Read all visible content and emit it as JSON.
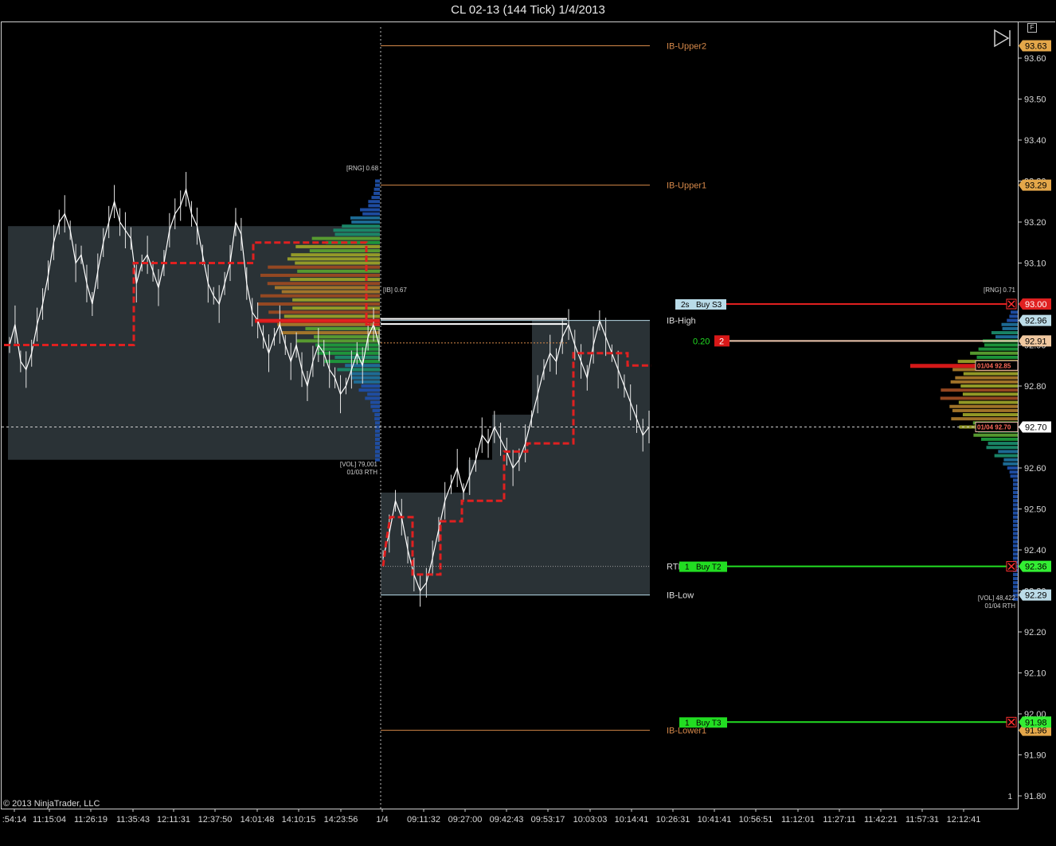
{
  "title": "CL 02-13 (144 Tick)  1/4/2013",
  "copyright": "© 2013 NinjaTrader, LLC",
  "panel_button": "F",
  "colors": {
    "orange": "#d6894a",
    "red": "#e02020",
    "green": "#22dd22",
    "lightblue": "#b9dbe8",
    "box": "#2a3236",
    "grid_text": "#d8d8d8"
  },
  "chart_data": {
    "type": "line",
    "y_axis": {
      "range": [
        91.76,
        93.67
      ],
      "ticks": [
        "93.60",
        "93.50",
        "93.40",
        "93.30",
        "93.20",
        "93.10",
        "93.00",
        "92.90",
        "92.80",
        "92.70",
        "92.60",
        "92.50",
        "92.40",
        "92.30",
        "92.20",
        "92.10",
        "92.00",
        "91.90",
        "91.80"
      ],
      "bottom_marker": "1"
    },
    "x_axis": {
      "ticks": [
        ":54:14",
        "11:15:04",
        "11:26:19",
        "11:35:43",
        "12:11:31",
        "12:37:50",
        "14:01:48",
        "14:10:15",
        "14:23:56",
        "1/4",
        "09:11:32",
        "09:27:00",
        "09:42:43",
        "09:53:17",
        "10:03:03",
        "10:14:41",
        "10:26:31",
        "10:41:41",
        "10:56:51",
        "11:12:01",
        "11:27:11",
        "11:42:21",
        "11:57:31",
        "12:12:41"
      ]
    },
    "levels": [
      {
        "name": "IB-Upper2",
        "price": 93.63,
        "tag": "93.63",
        "color": "orange"
      },
      {
        "name": "IB-Upper1",
        "price": 93.29,
        "tag": "93.29",
        "color": "orange"
      },
      {
        "name": "IB-High",
        "price": 92.96,
        "tag": "92.96",
        "color": "lightblue"
      },
      {
        "name": "RTH Open",
        "price": 92.36,
        "tag": "",
        "color": "gray"
      },
      {
        "name": "IB-Low",
        "price": 92.29,
        "tag": "92.29",
        "color": "lightblue"
      },
      {
        "name": "IB-Lower1",
        "price": 91.96,
        "tag": "91.96",
        "color": "orange"
      }
    ],
    "orders": [
      {
        "label": "Buy S3",
        "qty": "2s",
        "price": 93.0,
        "tag": "93.00",
        "kind": "stop"
      },
      {
        "label": "Buy T2",
        "qty": "1",
        "price": 92.36,
        "tag": "92.36",
        "kind": "target"
      },
      {
        "label": "Buy T3",
        "qty": "1",
        "price": 91.98,
        "tag": "91.98",
        "kind": "target"
      }
    ],
    "position": {
      "pnl": "0.20",
      "qty": "2",
      "price": 92.91,
      "tag": "92.91"
    },
    "current_price": {
      "price": 92.7,
      "tag": "92.70",
      "label": "01/04 92.70"
    },
    "poc_label": {
      "price": 92.85,
      "label": "01/04 92.85"
    },
    "profile_labels": {
      "prev_range": "[RNG] 0.68",
      "prev_ib": "[IB] 0.67",
      "prev_vol": "[VOL] 79,001",
      "prev_session": "01/03 RTH",
      "curr_range": "[RNG] 0.71",
      "curr_vol": "[VOL] 48,422",
      "curr_session": "01/04 RTH"
    },
    "prev_session_price": {
      "close_series": [
        92.9,
        92.95,
        92.86,
        92.84,
        92.88,
        92.95,
        93.0,
        93.07,
        93.15,
        93.2,
        93.22,
        93.18,
        93.1,
        93.12,
        93.05,
        93.0,
        93.08,
        93.15,
        93.2,
        93.25,
        93.2,
        93.18,
        93.16,
        93.05,
        93.1,
        93.12,
        93.08,
        93.04,
        93.1,
        93.18,
        93.22,
        93.24,
        93.28,
        93.22,
        93.19,
        93.12,
        93.05,
        93.02,
        93.0,
        93.05,
        93.1,
        93.2,
        93.17,
        93.05,
        92.98,
        92.96,
        92.92,
        92.88,
        92.92,
        92.95,
        92.9,
        92.86,
        92.9,
        92.84,
        92.8,
        92.86,
        92.9,
        92.88,
        92.84,
        92.82,
        92.78,
        92.8,
        92.84,
        92.88,
        92.85,
        92.92,
        92.95,
        92.9
      ]
    },
    "curr_session_price": {
      "close_series": [
        92.38,
        92.44,
        92.52,
        92.48,
        92.4,
        92.34,
        92.3,
        92.32,
        92.38,
        92.45,
        92.52,
        92.56,
        92.6,
        92.54,
        92.58,
        92.62,
        92.68,
        92.66,
        92.7,
        92.67,
        92.64,
        92.6,
        92.62,
        92.66,
        92.72,
        92.78,
        92.84,
        92.88,
        92.86,
        92.92,
        92.95,
        92.9,
        92.86,
        92.82,
        92.9,
        92.96,
        92.92,
        92.88,
        92.84,
        92.8,
        92.76,
        92.72,
        92.68,
        92.7
      ]
    }
  }
}
